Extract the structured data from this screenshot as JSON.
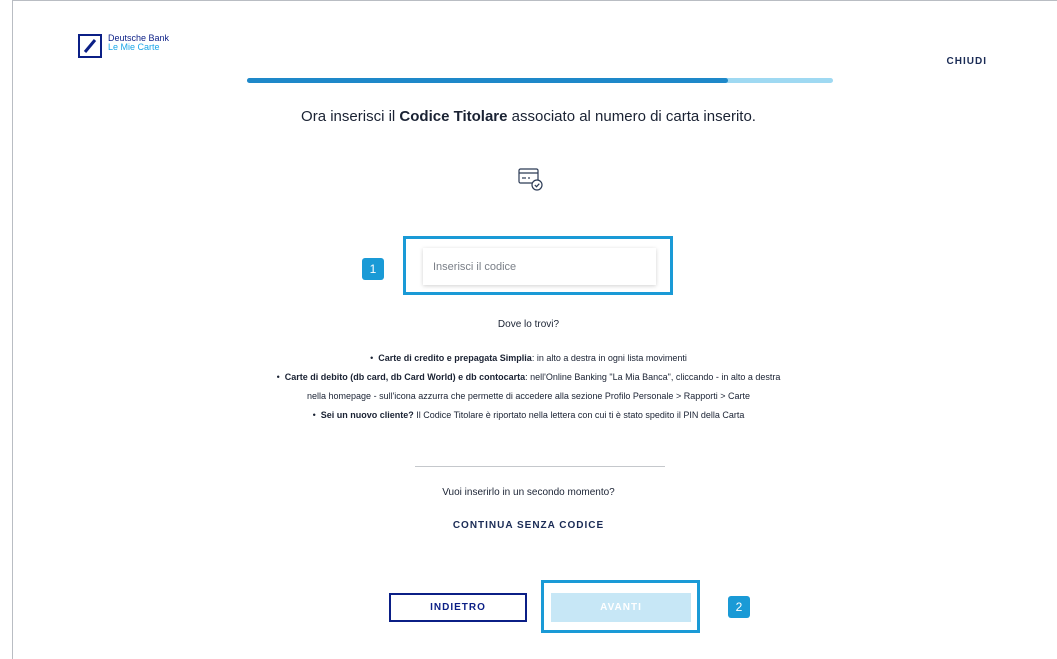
{
  "brand": {
    "line1": "Deutsche Bank",
    "line2": "Le Mie Carte"
  },
  "header": {
    "close_label": "CHIUDI"
  },
  "progress": {
    "fraction": 0.82
  },
  "title": {
    "prefix": "Ora inserisci il ",
    "bold": "Codice Titolare",
    "suffix": " associato al numero di carta inserito."
  },
  "code_input": {
    "placeholder": "Inserisci il codice",
    "value": ""
  },
  "help": {
    "question": "Dove lo trovi?",
    "items": [
      {
        "bold": "Carte di credito e prepagata Simplia",
        "text": ": in alto a destra in ogni lista movimenti"
      },
      {
        "bold": "Carte di debito (db card, db Card World) e db contocarta",
        "text": ": nell'Online Banking \"La Mia Banca\", cliccando - in alto a destra"
      },
      {
        "bold": "",
        "text": "nella homepage - sull'icona azzurra che permette di accedere alla sezione Profilo Personale > Rapporti > Carte"
      },
      {
        "bold": "Sei un nuovo cliente?",
        "text": " Il Codice Titolare è riportato nella lettera con cui ti è stato spedito il PIN della Carta"
      }
    ]
  },
  "later": {
    "question": "Vuoi inserirlo in un secondo momento?",
    "skip_label": "CONTINUA SENZA CODICE"
  },
  "buttons": {
    "back_label": "INDIETRO",
    "next_label": "AVANTI"
  },
  "callouts": {
    "first": "1",
    "second": "2"
  },
  "colors": {
    "brand_blue": "#0b1f86",
    "accent": "#1a9ad6",
    "progress_fill": "#1e88c9",
    "progress_track": "#9fd9f2"
  }
}
